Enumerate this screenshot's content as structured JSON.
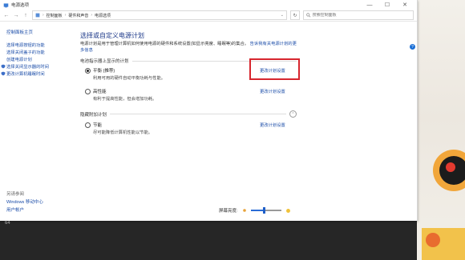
{
  "window": {
    "title": "电源选项"
  },
  "address": {
    "crumbs": [
      "控制面板",
      "硬件和声音",
      "电源选项"
    ],
    "search_placeholder": "搜索控制面板"
  },
  "sidebar": {
    "home": "控制面板主页",
    "items": [
      {
        "label": "选择电源按钮的功能"
      },
      {
        "label": "选择关闭盖子的功能"
      },
      {
        "label": "创建电源计划"
      },
      {
        "label": "选择关闭显示器的时间"
      },
      {
        "label": "更改计算机睡眠时间"
      }
    ],
    "see_also": "另请参阅",
    "bottom_links": [
      "Windows 移动中心",
      "用户帐户"
    ]
  },
  "main": {
    "title": "选择或自定义电源计划",
    "description_pre": "电源计划是用于管理计算机如何使用电源的硬件和系统设置(如显示亮度、睡眠等)的集合。",
    "description_link": "告诉我有关电源计划的更多信息",
    "group1_header": "电池指示器上显示的计划",
    "group2_header": "隐藏附加计划",
    "plans": [
      {
        "name": "平衡 (推荐)",
        "desc": "利用可用的硬件自动平衡功耗与性能。",
        "change": "更改计划设置",
        "checked": true
      },
      {
        "name": "高性能",
        "desc": "有利于提高性能，但会增加功耗。",
        "change": "更改计划设置",
        "checked": false
      },
      {
        "name": "节能",
        "desc": "尽可能降低计算机性能以节能。",
        "change": "更改计划设置",
        "checked": false
      }
    ],
    "brightness_label": "屏幕亮度:",
    "brightness_level": 0.45
  },
  "corner": "64",
  "colors": {
    "accent": "#1a4ca8",
    "highlight": "#d7262e",
    "slider": "#2a6cd6"
  }
}
